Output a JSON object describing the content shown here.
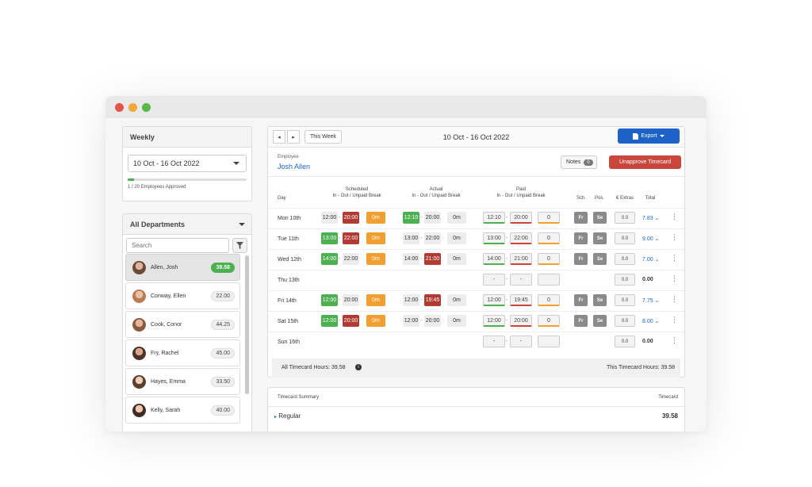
{
  "window": {
    "dots": [
      "#e5534b",
      "#f0a93a",
      "#57b846"
    ]
  },
  "weekly": {
    "title": "Weekly",
    "range": "10 Oct - 16 Oct 2022",
    "approved_text": "1 / 20 Employees Approved",
    "approved_fraction": 0.05
  },
  "departments": {
    "title": "All Departments",
    "search_placeholder": "Search",
    "employees": [
      {
        "name": "Allen, Josh",
        "hours": "39.58",
        "active": true
      },
      {
        "name": "Conway, Ellen",
        "hours": "22.00"
      },
      {
        "name": "Cook, Conor",
        "hours": "44.25"
      },
      {
        "name": "Fry, Rachel",
        "hours": "45.00"
      },
      {
        "name": "Hayes, Emma",
        "hours": "33.50"
      },
      {
        "name": "Kelly, Sarah",
        "hours": "40.00"
      }
    ]
  },
  "topbar": {
    "prev": "◂",
    "next": "▸",
    "this_week": "This Week",
    "range": "10 Oct - 16 Oct 2022",
    "export": "Export"
  },
  "employee": {
    "label": "Employee",
    "name": "Josh Allen"
  },
  "actions": {
    "notes": "Notes",
    "notes_count": "0",
    "unapprove": "Unapprove Timecard"
  },
  "columns": {
    "day": "Day",
    "scheduled": "Scheduled",
    "scheduled_sub": "In - Out / Unpaid Break",
    "actual": "Actual",
    "actual_sub": "In - Out / Unpaid Break",
    "paid": "Paid",
    "paid_sub": "In - Out / Unpaid Break",
    "sch": "Sch.",
    "pos": "Pos.",
    "extras": "€ Extras",
    "total": "Total"
  },
  "rows": [
    {
      "day": "Mon 10th",
      "s_in": "12:00",
      "s_out": "20:00",
      "s_break": "0m",
      "a_in": "12:10",
      "a_out": "20:00",
      "a_break": "0m",
      "p_in": "12:10",
      "p_out": "20:00",
      "p_break": "0",
      "sch": "Fr",
      "pos": "Se",
      "extras": "0.0",
      "total": "7.83",
      "kebab": "⋮"
    },
    {
      "day": "Tue 11th",
      "s_in": "13:00",
      "s_out": "22:00",
      "s_break": "0m",
      "a_in": "13:00",
      "a_out": "22:00",
      "a_break": "0m",
      "p_in": "13:00",
      "p_out": "22:00",
      "p_break": "0",
      "sch": "Fr",
      "pos": "Se",
      "extras": "0.0",
      "total": "9.00",
      "kebab": "⋮"
    },
    {
      "day": "Wed 12th",
      "s_in": "14:00",
      "s_out": "22:00",
      "s_break": "0m",
      "a_in": "14:00",
      "a_out": "21:00",
      "a_break": "0m",
      "p_in": "14:00",
      "p_out": "21:00",
      "p_break": "0",
      "sch": "Fr",
      "pos": "Se",
      "extras": "0.0",
      "total": "7.00",
      "kebab": "⋮"
    },
    {
      "day": "Thu 13th",
      "p_in": "-",
      "p_out": "-",
      "extras": "0.0",
      "total": "0.00",
      "kebab": "⋮"
    },
    {
      "day": "Fri 14th",
      "s_in": "12:00",
      "s_out": "20:00",
      "s_break": "0m",
      "a_in": "12:00",
      "a_out": "19:45",
      "a_break": "0m",
      "p_in": "12:00",
      "p_out": "19:45",
      "p_break": "0",
      "sch": "Fr",
      "pos": "Se",
      "extras": "0.0",
      "total": "7.75",
      "kebab": "⋮"
    },
    {
      "day": "Sat 15th",
      "s_in": "12:00",
      "s_out": "20:00",
      "s_break": "0m",
      "a_in": "12:00",
      "a_out": "20:00",
      "a_break": "0m",
      "p_in": "12:00",
      "p_out": "20:00",
      "p_break": "0",
      "sch": "Fr",
      "pos": "Se",
      "extras": "0.0",
      "total": "8.00",
      "kebab": "⋮"
    },
    {
      "day": "Sun 16th",
      "p_in": "-",
      "p_out": "-",
      "extras": "0.0",
      "total": "0.00",
      "kebab": "⋮"
    }
  ],
  "footer": {
    "all_hours": "All Timecard Hours: 39.58",
    "this_hours": "This Timecard Hours: 39.58"
  },
  "summary": {
    "title": "Timecard Summary",
    "col": "Timecard",
    "row_label": "Regular",
    "row_value": "39.58"
  }
}
